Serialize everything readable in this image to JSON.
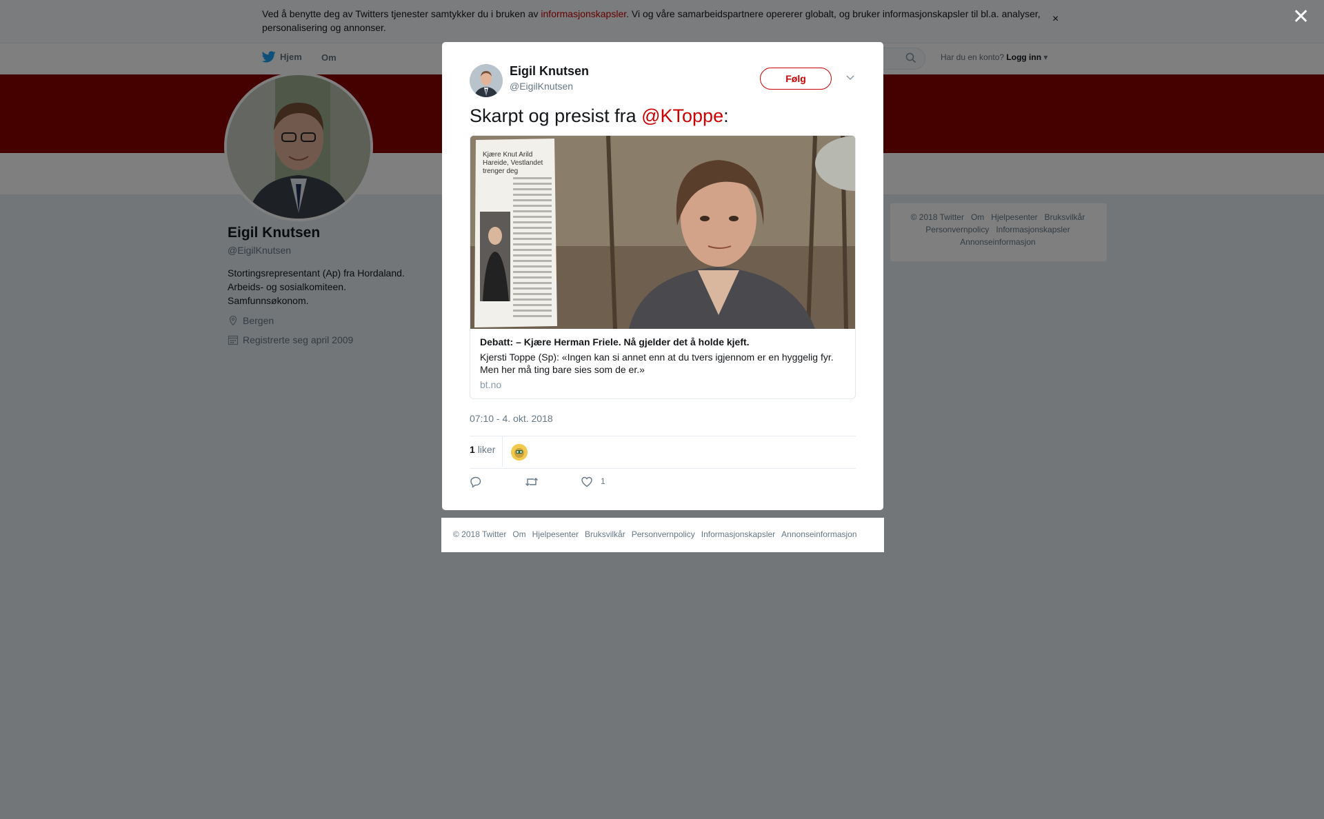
{
  "cookie_bar": {
    "text_before": "Ved å benytte deg av Twitters tjenester samtykker du i bruken av ",
    "link": "informasjonskapsler",
    "text_after": ". Vi og våre samarbeidspartnere opererer globalt, og bruker informasjonskapsler til bl.a. analyser, personalisering og annonser.",
    "close": "×"
  },
  "nav": {
    "home": "Hjem",
    "about": "Om",
    "login_prompt": "Har du en konto?",
    "login": "Logg inn"
  },
  "profile": {
    "name": "Eigil Knutsen",
    "handle": "@EigilKnutsen",
    "bio_lines": [
      "Stortingsrepresentant (Ap) fra Hordaland.",
      "Arbeids- og sosialkomiteen.",
      "Samfunnsøkonom."
    ],
    "location": "Bergen",
    "joined": "Registrerte seg april 2009"
  },
  "side_footer": [
    "© 2018 Twitter",
    "Om",
    "Hjelpesenter",
    "Bruksvilkår",
    "Personvernpolicy",
    "Informasjonskapsler",
    "Annonseinformasjon"
  ],
  "overlay": {
    "close": "✕"
  },
  "tweet": {
    "author_name": "Eigil Knutsen",
    "author_handle": "@EigilKnutsen",
    "follow_label": "Følg",
    "text_before": "Skarpt og presist fra ",
    "mention": "@KToppe",
    "text_after": ":",
    "card": {
      "title": "Debatt: – Kjære Herman Friele. Nå gjelder det å holde kjeft.",
      "description": "Kjersti Toppe (Sp): «Ingen kan si annet enn at du tvers igjennom er en hyggelig fyr. Men her må ting bare sies som de er.»",
      "domain": "bt.no",
      "clipping_headline": "Kjære Knut Arild Hareide, Vestlandet trenger deg"
    },
    "timestamp": "07:10 - 4. okt. 2018",
    "likes_number": "1",
    "likes_label": "liker",
    "like_action_count": "1"
  },
  "modal_footer": [
    "© 2018 Twitter",
    "Om",
    "Hjelpesenter",
    "Bruksvilkår",
    "Personvernpolicy",
    "Informasjonskapsler",
    "Annonseinformasjon"
  ],
  "colors": {
    "accent": "#cc0000",
    "banner": "#8b0000"
  }
}
